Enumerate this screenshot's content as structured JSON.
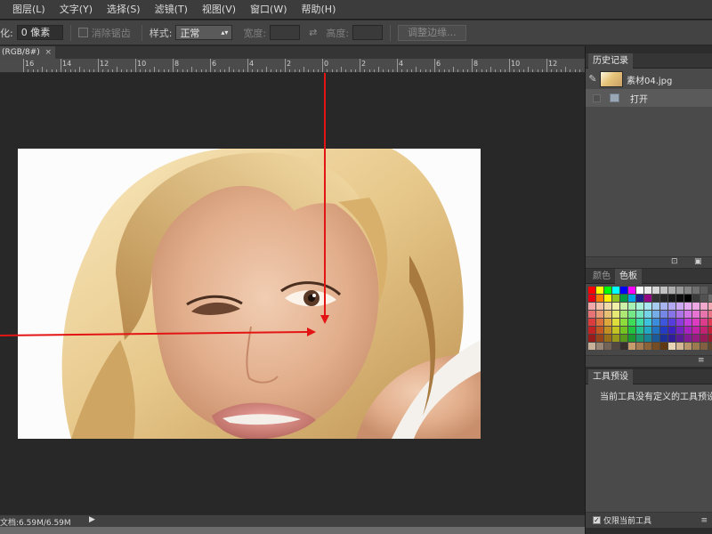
{
  "menu": [
    "图层(L)",
    "文字(Y)",
    "选择(S)",
    "滤镜(T)",
    "视图(V)",
    "窗口(W)",
    "帮助(H)"
  ],
  "options": {
    "feather_label": "化:",
    "feather_value": "0 像素",
    "antialias_label": "消除锯齿",
    "style_label": "样式:",
    "style_value": "正常",
    "width_label": "宽度:",
    "height_label": "高度:",
    "refine_button": "调整边缘..."
  },
  "document": {
    "tab_label": "(RGB/8#)",
    "close": "×"
  },
  "ruler": {
    "labels": [
      "16",
      "14",
      "12",
      "10",
      "8",
      "6",
      "4",
      "2",
      "0",
      "2",
      "4",
      "6",
      "8",
      "10",
      "12"
    ]
  },
  "status": {
    "doc_info": "文档:6.59M/6.59M",
    "arrow": "▶"
  },
  "history": {
    "tab": "历史记录",
    "snapshot_label": "素材04.jpg",
    "step_label": "打开"
  },
  "color_panel": {
    "tab_color": "颜色",
    "tab_swatches": "色板"
  },
  "tool_presets": {
    "tab": "工具预设",
    "message": "当前工具没有定义的工具预设",
    "current_only_label": "仅限当前工具",
    "current_only_checked": "true"
  },
  "annotation_color": "#e31414"
}
